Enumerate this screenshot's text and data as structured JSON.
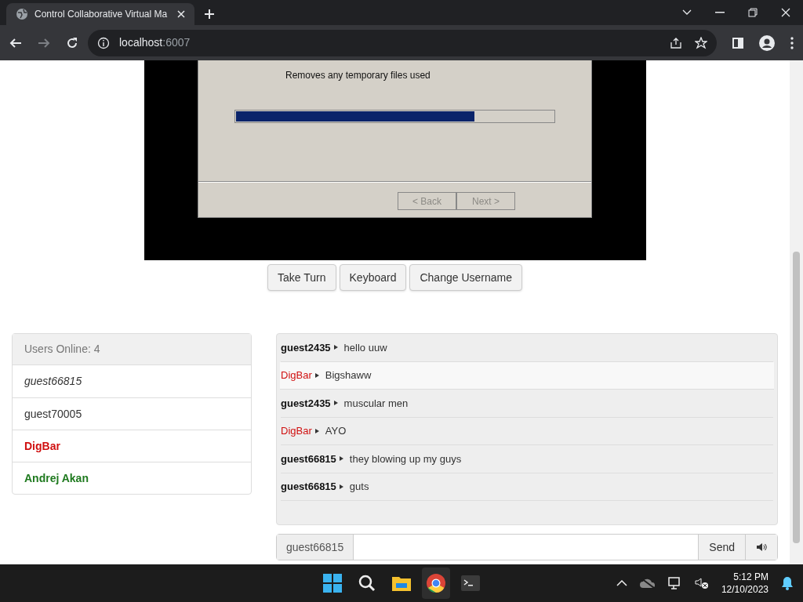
{
  "browser": {
    "tab_title": "Control Collaborative Virtual Ma",
    "address_host": "localhost",
    "address_port": ":6007"
  },
  "vm_screen": {
    "dialog_text": "Removes any temporary files used",
    "progress": {
      "level": 0.75
    },
    "buttons": [
      {
        "label": "< Back",
        "disabled": true
      },
      {
        "label": "Next >",
        "disabled": true
      }
    ]
  },
  "controls": [
    "Take Turn",
    "Keyboard",
    "Change Username"
  ],
  "users": {
    "heading": "Users Online: 4",
    "items": [
      {
        "name": "guest66815",
        "kind": "self"
      },
      {
        "name": "guest70005",
        "kind": "guest"
      },
      {
        "name": "DigBar",
        "kind": "admin"
      },
      {
        "name": "Andrej Akan",
        "kind": "moderator"
      }
    ]
  },
  "chat": {
    "messages": [
      {
        "user": "guest2435",
        "kind": "guest",
        "text": "hello uuw",
        "hovered": false
      },
      {
        "user": "DigBar",
        "kind": "admin",
        "text": "Bigshaww",
        "hovered": true
      },
      {
        "user": "guest2435",
        "kind": "guest",
        "text": "muscular men",
        "hovered": false
      },
      {
        "user": "DigBar",
        "kind": "admin",
        "text": "AYO",
        "hovered": false
      },
      {
        "user": "guest66815",
        "kind": "guest",
        "text": "they blowing up my guys",
        "hovered": false
      },
      {
        "user": "guest66815",
        "kind": "guest",
        "text": "guts",
        "hovered": false
      }
    ],
    "username": "guest66815",
    "send": "Send"
  },
  "taskbar": {
    "time": "5:12 PM",
    "date": "12/10/2023"
  }
}
